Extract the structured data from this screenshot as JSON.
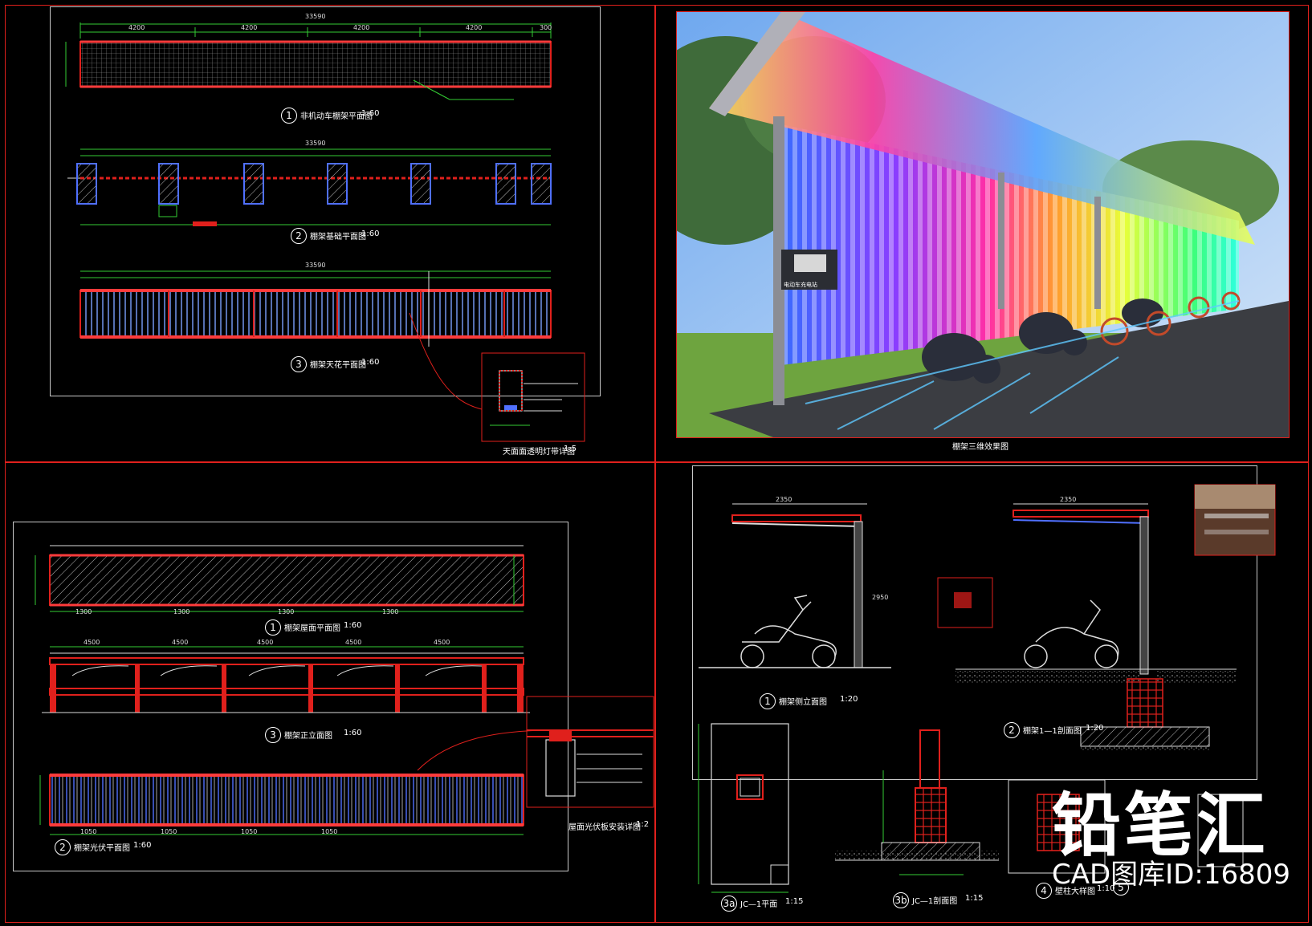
{
  "drawings": {
    "d1": {
      "num": "1",
      "title": "非机动车棚架平面图",
      "scale": "1:60"
    },
    "d2": {
      "num": "2",
      "title": "棚架基础平面图",
      "scale": "1:60"
    },
    "d3": {
      "num": "3",
      "title": "棚架天花平面图",
      "scale": "1:60"
    },
    "d_detail": {
      "title": "天面面透明灯带详图",
      "scale": "1:5"
    },
    "render": {
      "title": "棚架三维效果图",
      "charger_label": "电动车充电站"
    },
    "b1": {
      "num": "1",
      "title": "棚架屋面平面图",
      "scale": "1:60"
    },
    "b3": {
      "num": "3",
      "title": "棚架正立面图",
      "scale": "1:60"
    },
    "b2": {
      "num": "2",
      "title": "棚架光伏平面图",
      "scale": "1:60"
    },
    "b_detail": {
      "title": "屋面光伏板安装详图",
      "scale": "1:2"
    },
    "r1": {
      "num": "1",
      "title": "棚架侧立面图",
      "scale": "1:20"
    },
    "r2": {
      "num": "2",
      "title": "棚架1—1剖面图",
      "scale": "1:20"
    },
    "r3a": {
      "num": "3a",
      "title": "JC—1平面",
      "scale": "1:15"
    },
    "r3b": {
      "num": "3b",
      "title": "JC—1剖面图",
      "scale": "1:15"
    },
    "r4": {
      "num": "4",
      "title": "壁柱大样图",
      "scale": "1:10"
    },
    "r5": {
      "num": "5"
    }
  },
  "dims": {
    "total": "33590",
    "span": "4200",
    "span2": "4500",
    "bay": "1300",
    "pv": "1050",
    "depth": "2350",
    "height": "2950",
    "end": "300"
  },
  "watermark": {
    "brand": "铅笔汇",
    "id_text": "CAD图库ID:16809"
  }
}
